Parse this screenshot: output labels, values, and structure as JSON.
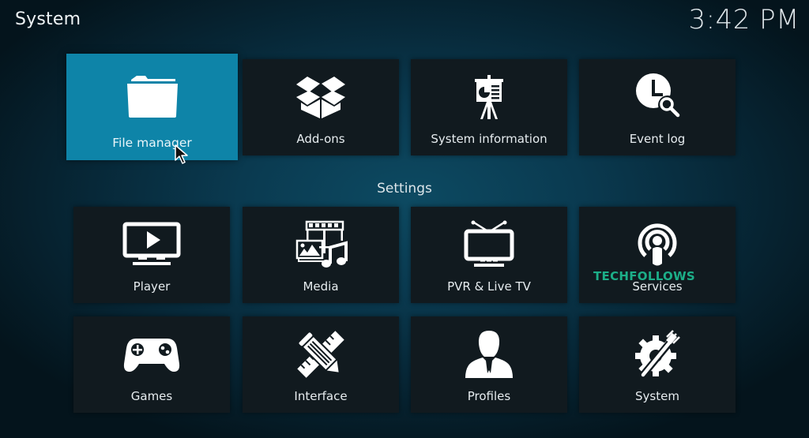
{
  "header": {
    "title": "System",
    "clock": "3:42 PM"
  },
  "top_row": [
    {
      "label": "File manager",
      "icon": "folder-icon",
      "focused": true
    },
    {
      "label": "Add-ons",
      "icon": "open-box-icon",
      "focused": false
    },
    {
      "label": "System information",
      "icon": "presentation-easel-icon",
      "focused": false
    },
    {
      "label": "Event log",
      "icon": "clock-search-icon",
      "focused": false
    }
  ],
  "settings": {
    "heading": "Settings",
    "items": [
      {
        "label": "Player",
        "icon": "monitor-play-icon"
      },
      {
        "label": "Media",
        "icon": "media-film-photo-music-icon"
      },
      {
        "label": "PVR & Live TV",
        "icon": "tv-antenna-icon"
      },
      {
        "label": "Services",
        "icon": "broadcast-podcast-icon"
      },
      {
        "label": "Games",
        "icon": "gamepad-icon"
      },
      {
        "label": "Interface",
        "icon": "pencil-ruler-icon"
      },
      {
        "label": "Profiles",
        "icon": "person-icon"
      },
      {
        "label": "System",
        "icon": "gear-wrench-icon"
      }
    ]
  },
  "watermark": "TECHFOLLOWS",
  "colors": {
    "focus": "#0e84a8",
    "tile": "#111a1f",
    "watermark": "#1cae88"
  }
}
